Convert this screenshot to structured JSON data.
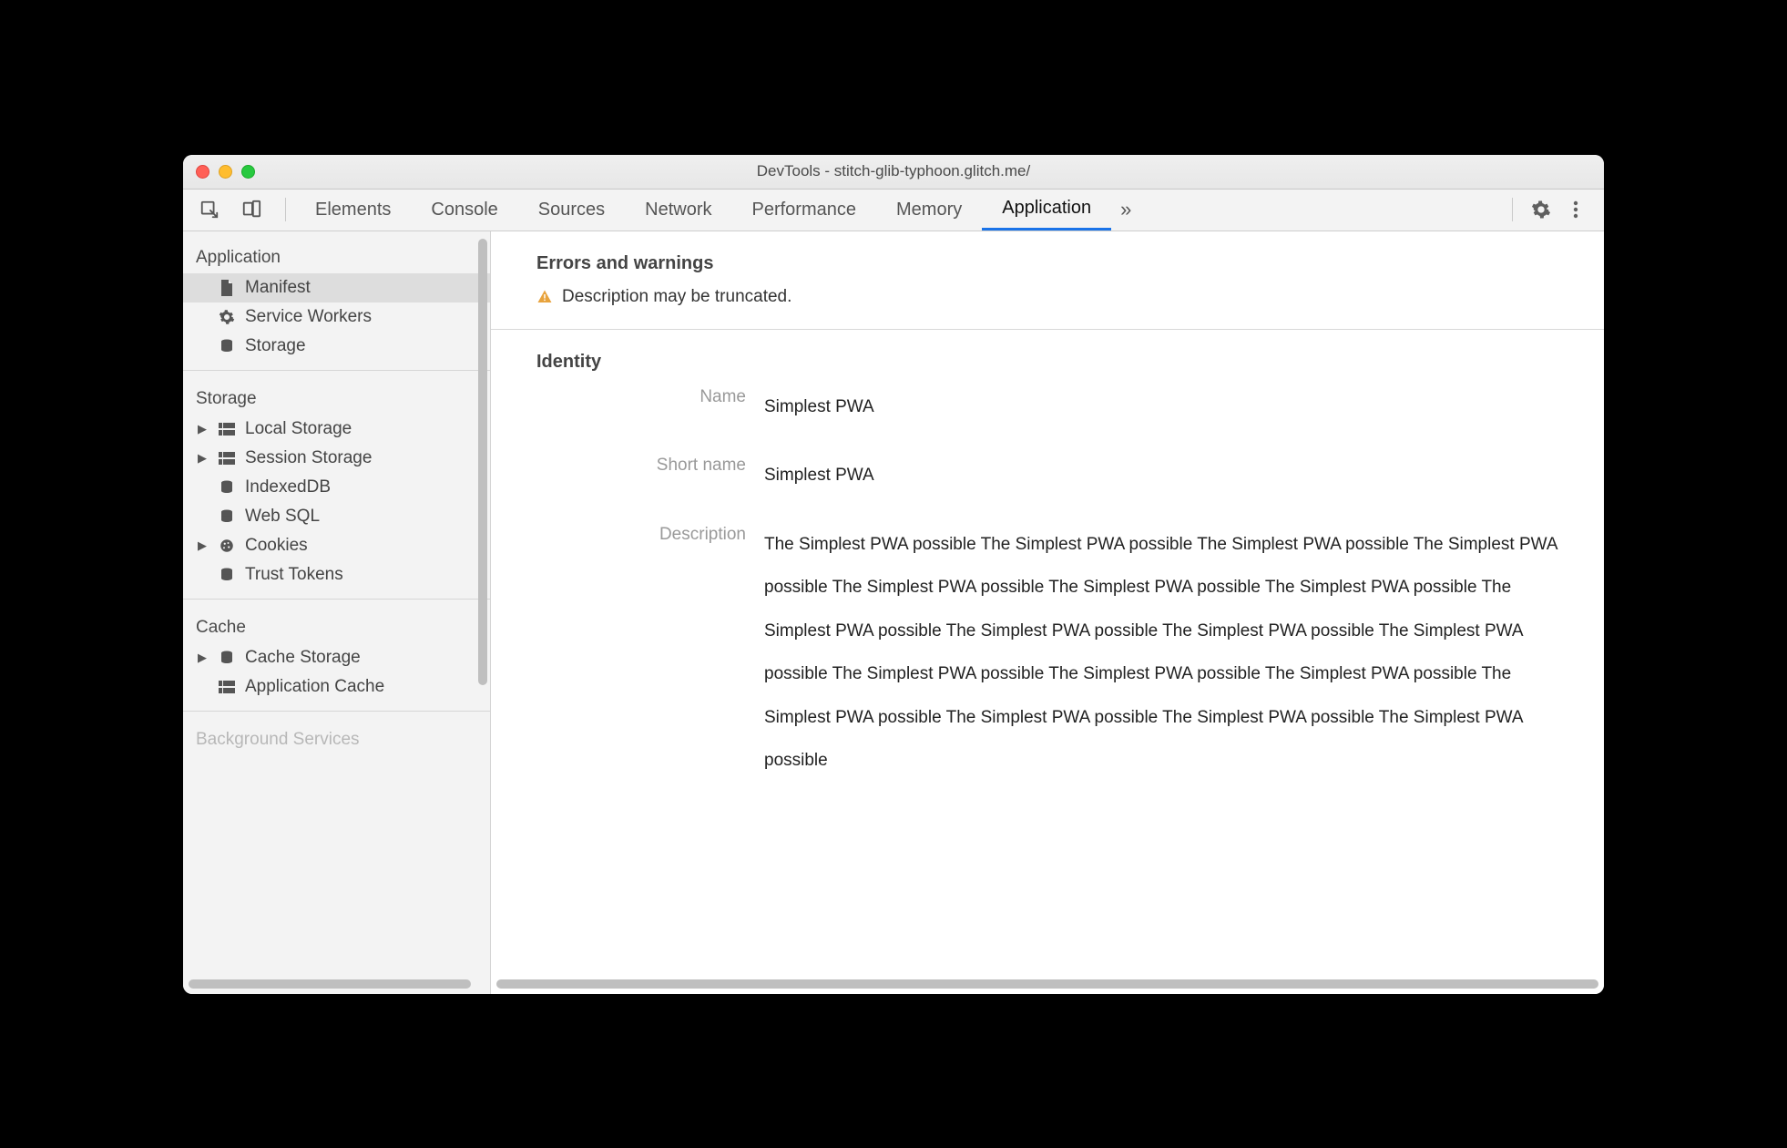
{
  "window": {
    "title": "DevTools - stitch-glib-typhoon.glitch.me/"
  },
  "toolbar": {
    "tabs": [
      "Elements",
      "Console",
      "Sources",
      "Network",
      "Performance",
      "Memory",
      "Application"
    ],
    "active_tab": "Application"
  },
  "sidebar": {
    "sections": [
      {
        "title": "Application",
        "items": [
          {
            "label": "Manifest",
            "icon": "file-icon",
            "selected": true,
            "expandable": false
          },
          {
            "label": "Service Workers",
            "icon": "gear-icon",
            "selected": false,
            "expandable": false
          },
          {
            "label": "Storage",
            "icon": "database-icon",
            "selected": false,
            "expandable": false
          }
        ]
      },
      {
        "title": "Storage",
        "items": [
          {
            "label": "Local Storage",
            "icon": "grid-icon",
            "selected": false,
            "expandable": true
          },
          {
            "label": "Session Storage",
            "icon": "grid-icon",
            "selected": false,
            "expandable": true
          },
          {
            "label": "IndexedDB",
            "icon": "database-icon",
            "selected": false,
            "expandable": false
          },
          {
            "label": "Web SQL",
            "icon": "database-icon",
            "selected": false,
            "expandable": false
          },
          {
            "label": "Cookies",
            "icon": "cookie-icon",
            "selected": false,
            "expandable": true
          },
          {
            "label": "Trust Tokens",
            "icon": "database-icon",
            "selected": false,
            "expandable": false
          }
        ]
      },
      {
        "title": "Cache",
        "items": [
          {
            "label": "Cache Storage",
            "icon": "database-icon",
            "selected": false,
            "expandable": true
          },
          {
            "label": "Application Cache",
            "icon": "grid-icon",
            "selected": false,
            "expandable": false
          }
        ]
      },
      {
        "title": "Background Services",
        "items": []
      }
    ]
  },
  "main": {
    "errors_section": {
      "title": "Errors and warnings",
      "warnings": [
        "Description may be truncated."
      ]
    },
    "identity_section": {
      "title": "Identity",
      "rows": {
        "name": {
          "label": "Name",
          "value": "Simplest PWA"
        },
        "short_name": {
          "label": "Short name",
          "value": "Simplest PWA"
        },
        "description": {
          "label": "Description",
          "value": "The Simplest PWA possible The Simplest PWA possible The Simplest PWA possible The Simplest PWA possible The Simplest PWA possible The Simplest PWA possible The Simplest PWA possible The Simplest PWA possible The Simplest PWA possible The Simplest PWA possible The Simplest PWA possible The Simplest PWA possible The Simplest PWA possible The Simplest PWA possible The Simplest PWA possible The Simplest PWA possible The Simplest PWA possible The Simplest PWA possible"
        }
      }
    }
  }
}
